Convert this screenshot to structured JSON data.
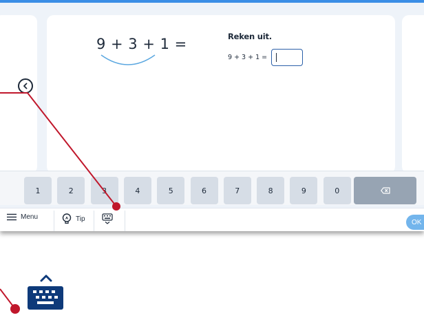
{
  "exercise": {
    "big_equation": "9 + 3 + 1 =",
    "instruction": "Reken uit.",
    "small_equation": "9 + 3 + 1 =",
    "answer_value": ""
  },
  "keypad": {
    "keys": [
      "1",
      "2",
      "3",
      "4",
      "5",
      "6",
      "7",
      "8",
      "9",
      "0"
    ]
  },
  "toolbar": {
    "menu_label": "Menu",
    "tip_label": "Tip",
    "ok_label": "OK"
  },
  "colors": {
    "accent": "#3b8ee6",
    "callout_red": "#c0172b",
    "navy": "#0e3a7a",
    "ok_button": "#73b5ec"
  },
  "icons": [
    "chevron-left-icon",
    "backspace-icon",
    "hamburger-icon",
    "lightbulb-icon",
    "keyboard-icon",
    "caret-up-icon"
  ]
}
